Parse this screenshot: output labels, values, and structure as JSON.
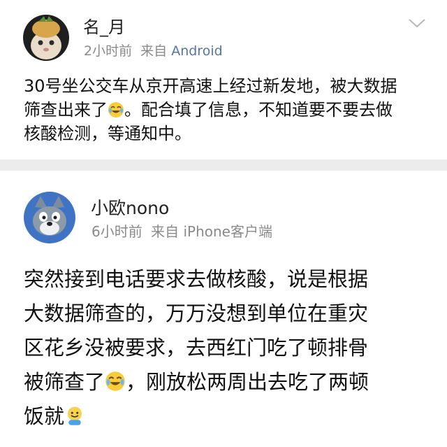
{
  "posts": [
    {
      "username": "名_月",
      "time": "2小时前",
      "source_prefix": "来自",
      "source": "Android",
      "lines": [
        "30号坐公交车从京开高速上经过新发地，被大数据",
        "筛查出来了",
        "。配合填了信息，不知道要不要去做",
        "核酸检测，等通知中。"
      ],
      "emojis": [
        "laugh-cry-emoji"
      ],
      "avatar": "cat-with-pineapple-hat-icon"
    },
    {
      "username": "小欧nono",
      "time": "6小时前",
      "source_prefix": "来自",
      "source": "iPhone客户端",
      "lines": [
        "突然接到电话要求去做核酸，说是根据",
        "大数据筛查的，万万没想到单位在重灾",
        "区花乡没被要求，去西红门吃了顿排骨",
        "被筛查了",
        "，刚放松两周出去吃了两顿",
        "饭就"
      ],
      "emojis": [
        "laugh-cry-emoji",
        "doge-emoji"
      ],
      "avatar": "tom-cat-cartoon-icon"
    }
  ],
  "colors": {
    "meta_gray": "#8a8a8a",
    "link_blue": "#5575a6",
    "divider": "#ececec"
  }
}
